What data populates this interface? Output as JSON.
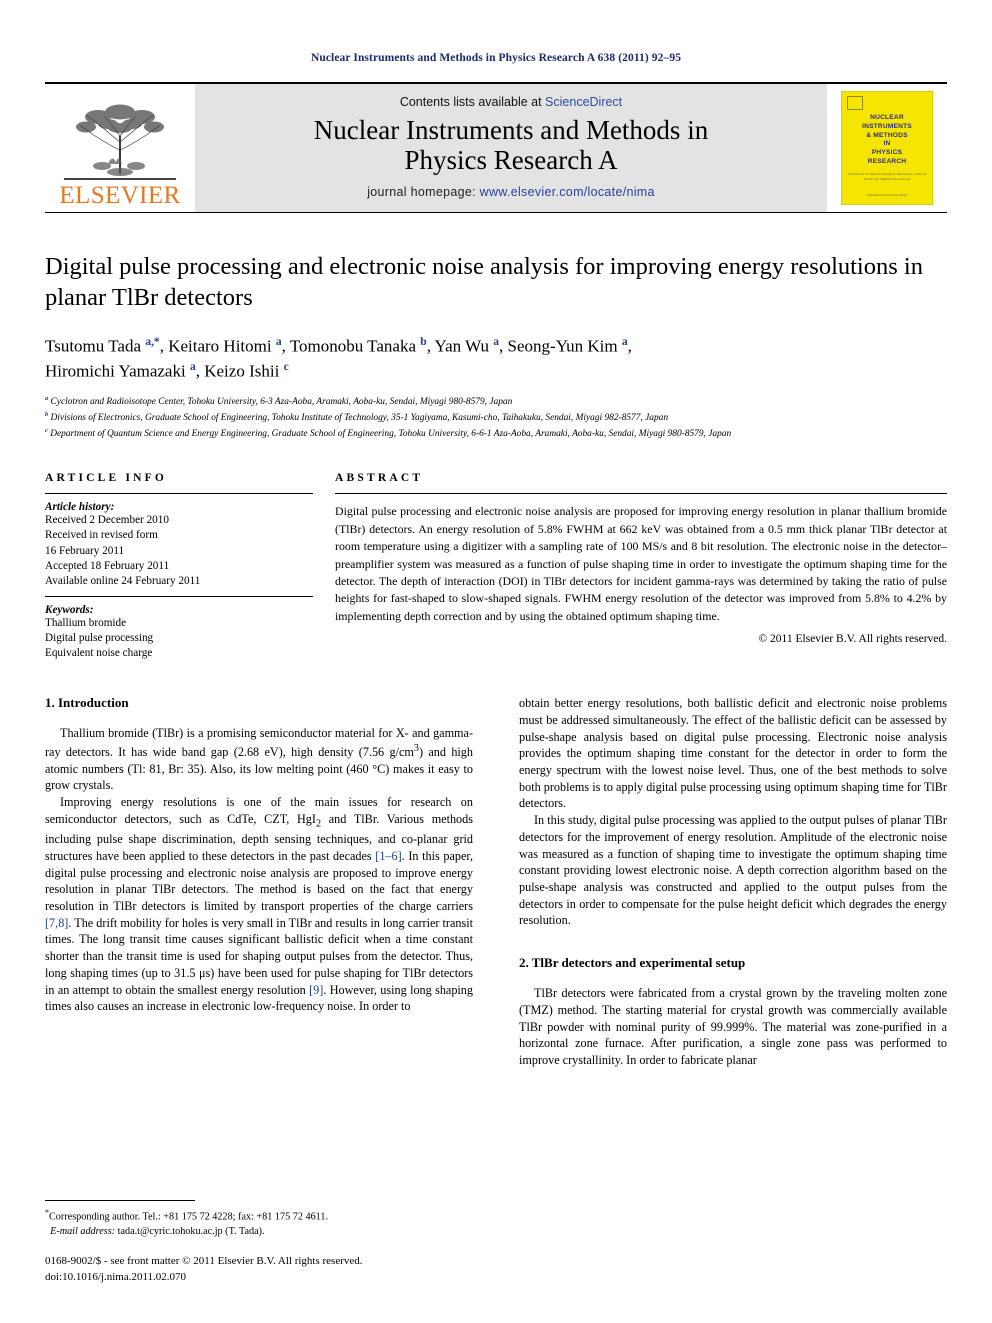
{
  "running_head": "Nuclear Instruments and Methods in Physics Research A 638 (2011) 92–95",
  "masthead": {
    "publisher": "ELSEVIER",
    "contents_prefix": "Contents lists available at ",
    "contents_link": "ScienceDirect",
    "journal_title_line1": "Nuclear Instruments and Methods in",
    "journal_title_line2": "Physics Research A",
    "homepage_prefix": "journal homepage: ",
    "homepage_url": "www.elsevier.com/locate/nima",
    "cover": {
      "title_lines": [
        "NUCLEAR",
        "INSTRUMENTS",
        "& METHODS",
        "IN",
        "PHYSICS",
        "RESEARCH"
      ],
      "subtitle": "The Tutorial in Medical Imaging for Resonance, Artificial Neural and Simulated Scanners D",
      "footer": "Summarized in Science Daily"
    }
  },
  "article": {
    "title": "Digital pulse processing and electronic noise analysis for improving energy resolutions in planar TlBr detectors",
    "authors_line1": "Tsutomu Tada <sup>a,*</sup>, Keitaro Hitomi <sup>a</sup>, Tomonobu Tanaka <sup>b</sup>, Yan Wu <sup>a</sup>, Seong-Yun Kim <sup>a</sup>,",
    "authors_line2": "Hiromichi Yamazaki <sup>a</sup>, Keizo Ishii <sup>c</sup>",
    "affiliations": [
      "<sup>a</sup> Cyclotron and Radioisotope Center, Tohoku University, 6-3 Aza-Aoba, Aramaki, Aoba-ku, Sendai, Miyagi 980-8579, Japan",
      "<sup>b</sup> Divisions of Electronics, Graduate School of Engineering, Tohoku Institute of Technology, 35-1 Yagiyama, Kasumi-cho, Taihakuku, Sendai, Miyagi 982-8577, Japan",
      "<sup>c</sup> Department of Quantum Science and Energy Engineering, Graduate School of Engineering, Tohoku University, 6-6-1 Aza-Aoba, Aramaki, Aoba-ku, Sendai, Miyagi 980-8579, Japan"
    ]
  },
  "article_info": {
    "heading": "ARTICLE INFO",
    "history_label": "Article history:",
    "history_lines": [
      "Received 2 December 2010",
      "Received in revised form",
      "16 February 2011",
      "Accepted 18 February 2011",
      "Available online 24 February 2011"
    ],
    "keywords_label": "Keywords:",
    "keywords": [
      "Thallium bromide",
      "Digital pulse processing",
      "Equivalent noise charge"
    ]
  },
  "abstract": {
    "heading": "ABSTRACT",
    "text": "Digital pulse processing and electronic noise analysis are proposed for improving energy resolution in planar thallium bromide (TlBr) detectors. An energy resolution of 5.8% FWHM at 662 keV was obtained from a 0.5 mm thick planar TlBr detector at room temperature using a digitizer with a sampling rate of 100 MS/s and 8 bit resolution. The electronic noise in the detector–preamplifier system was measured as a function of pulse shaping time in order to investigate the optimum shaping time for the detector. The depth of interaction (DOI) in TlBr detectors for incident gamma-rays was determined by taking the ratio of pulse heights for fast-shaped to slow-shaped signals. FWHM energy resolution of the detector was improved from 5.8% to 4.2% by implementing depth correction and by using the obtained optimum shaping time.",
    "copyright": "© 2011 Elsevier B.V. All rights reserved."
  },
  "sections": {
    "intro_heading": "1.  Introduction",
    "intro_p1": "Thallium bromide (TlBr) is a promising semiconductor material for X- and gamma-ray detectors. It has wide band gap (2.68 eV), high density (7.56 g/cm<sup>3</sup>) and high atomic numbers (Tl: 81, Br: 35). Also, its low melting point (460 °C) makes it easy to grow crystals.",
    "intro_p2": "Improving energy resolutions is one of the main issues for research on semiconductor detectors, such as CdTe, CZT, HgI<sub>2</sub> and TlBr. Various methods including pulse shape discrimination, depth sensing techniques, and co-planar grid structures have been applied to these detectors in the past decades <span class=\"ref\">[1–6]</span>. In this paper, digital pulse processing and electronic noise analysis are proposed to improve energy resolution in planar TlBr detectors. The method is based on the fact that energy resolution in TlBr detectors is limited by transport properties of the charge carriers <span class=\"ref\">[7,8]</span>. The drift mobility for holes is very small in TlBr and results in long carrier transit times. The long transit time causes significant ballistic deficit when a time constant shorter than the transit time is used for shaping output pulses from the detector. Thus, long shaping times (up to 31.5 μs) have been used for pulse shaping for TlBr detectors in an attempt to obtain the smallest energy resolution <span class=\"ref\">[9]</span>. However, using long shaping times also causes an increase in electronic low-frequency noise. In order to",
    "intro_p3": "obtain better energy resolutions, both ballistic deficit and electronic noise problems must be addressed simultaneously. The effect of the ballistic deficit can be assessed by pulse-shape analysis based on digital pulse processing. Electronic noise analysis provides the optimum shaping time constant for the detector in order to form the energy spectrum with the lowest noise level. Thus, one of the best methods to solve both problems is to apply digital pulse processing using optimum shaping time for TlBr detectors.",
    "intro_p4": "In this study, digital pulse processing was applied to the output pulses of planar TlBr detectors for the improvement of energy resolution. Amplitude of the electronic noise was measured as a function of shaping time to investigate the optimum shaping time constant providing lowest electronic noise. A depth correction algorithm based on the pulse-shape analysis was constructed and applied to the output pulses from the detectors in order to compensate for the pulse height deficit which degrades the energy resolution.",
    "setup_heading": "2.  TlBr detectors and experimental setup",
    "setup_p1": "TlBr detectors were fabricated from a crystal grown by the traveling molten zone (TMZ) method. The starting material for crystal growth was commercially available TlBr powder with nominal purity of 99.999%. The material was zone-purified in a horizontal zone furnace. After purification, a single zone pass was performed to improve crystallinity. In order to fabricate planar"
  },
  "footer": {
    "corresponding": "<span class=\"star\">*</span>Corresponding author. Tel.: +81 175 72 4228; fax: +81 175 72 4611.",
    "email_label": "E-mail address:",
    "email": "tada.t@cyric.tohoku.ac.jp (T. Tada).",
    "issn_line": "0168-9002/$ - see front matter © 2011 Elsevier B.V. All rights reserved.",
    "doi_line": "doi:10.1016/j.nima.2011.02.070"
  },
  "colors": {
    "running_head": "#1a2a6c",
    "elsevier_orange": "#E87722",
    "link_blue": "#2b4ca0",
    "cover_yellow": "#f5e500"
  }
}
